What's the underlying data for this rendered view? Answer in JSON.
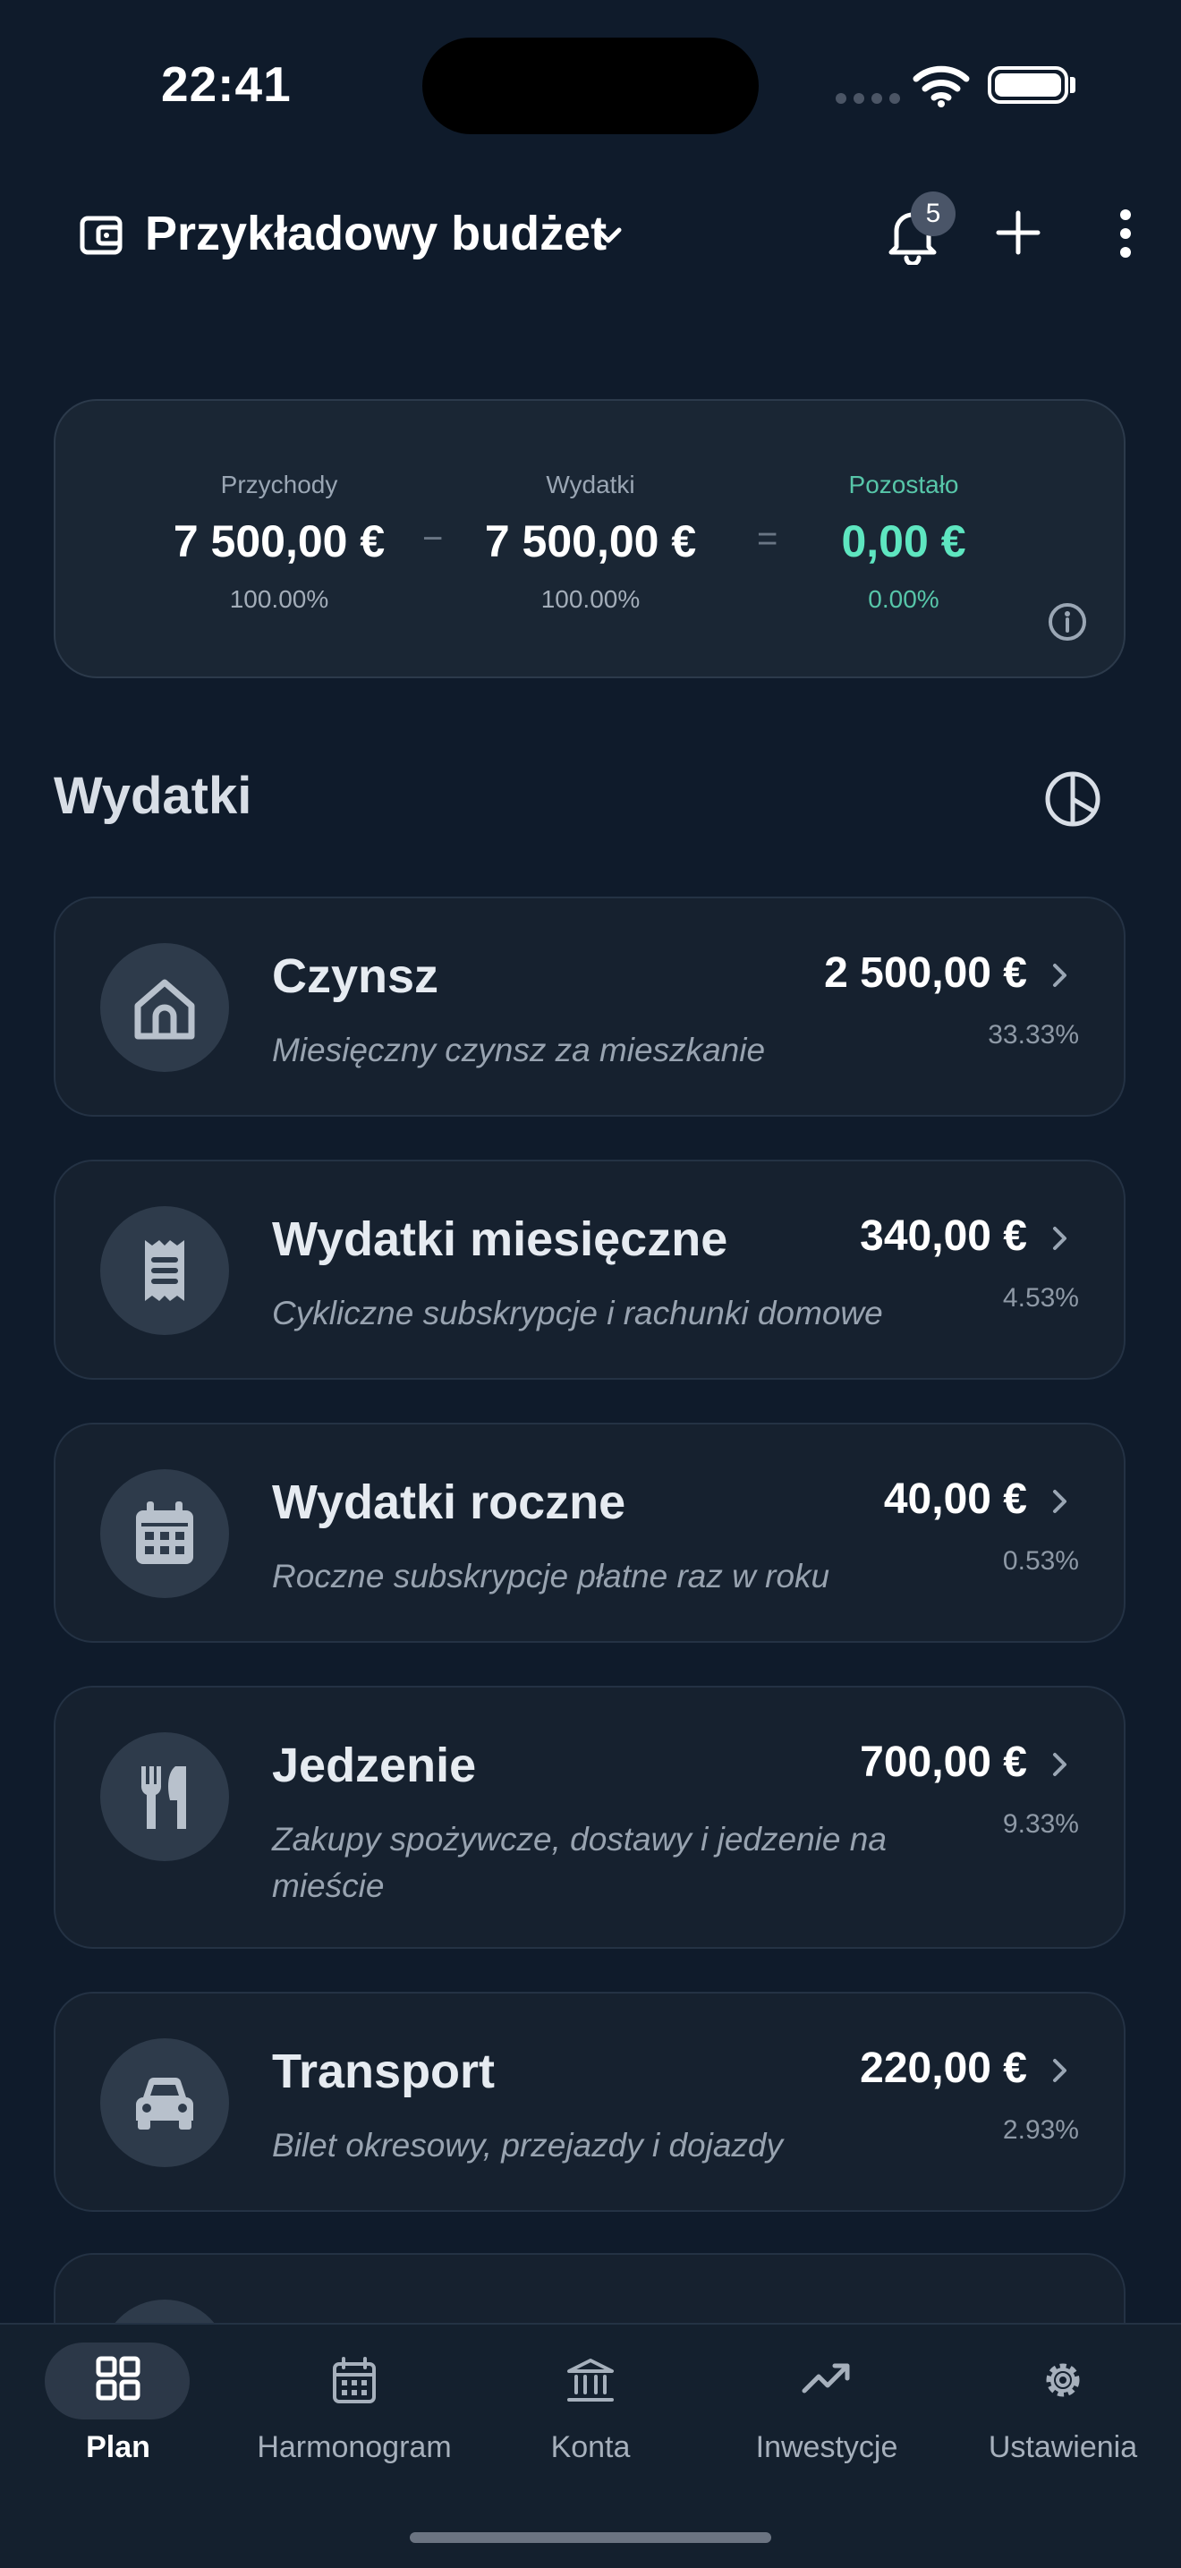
{
  "status_bar": {
    "time": "22:41"
  },
  "header": {
    "budget_name": "Przykładowy budżet",
    "notification_count": "5"
  },
  "summary": {
    "income": {
      "label": "Przychody",
      "value": "7 500,00 €",
      "percent": "100.00%"
    },
    "expenses": {
      "label": "Wydatki",
      "value": "7 500,00 €",
      "percent": "100.00%"
    },
    "remaining": {
      "label": "Pozostało",
      "value": "0,00 €",
      "percent": "0.00%"
    },
    "minus": "−",
    "equals": "=",
    "remaining_color": "#5ee6c0"
  },
  "section": {
    "title": "Wydatki"
  },
  "categories": [
    {
      "icon": "house-icon",
      "name": "Czynsz",
      "description": "Miesięczny czynsz za mieszkanie",
      "amount": "2 500,00 €",
      "percent": "33.33%"
    },
    {
      "icon": "receipt-icon",
      "name": "Wydatki miesięczne",
      "description": "Cykliczne subskrypcje i rachunki domowe",
      "amount": "340,00 €",
      "percent": "4.53%"
    },
    {
      "icon": "calendar-icon",
      "name": "Wydatki roczne",
      "description": "Roczne subskrypcje płatne raz w roku",
      "amount": "40,00 €",
      "percent": "0.53%"
    },
    {
      "icon": "fork-knife-icon",
      "name": "Jedzenie",
      "description": "Zakupy spożywcze, dostawy i jedzenie na mieście",
      "amount": "700,00 €",
      "percent": "9.33%"
    },
    {
      "icon": "car-icon",
      "name": "Transport",
      "description": "Bilet okresowy, przejazdy i dojazdy",
      "amount": "220,00 €",
      "percent": "2.93%"
    }
  ],
  "nav": [
    {
      "icon": "grid-icon",
      "label": "Plan",
      "active": true
    },
    {
      "icon": "calendar-icon",
      "label": "Harmonogram"
    },
    {
      "icon": "bank-icon",
      "label": "Konta"
    },
    {
      "icon": "trending-up-icon",
      "label": "Inwestycje"
    },
    {
      "icon": "gear-icon",
      "label": "Ustawienia"
    }
  ]
}
